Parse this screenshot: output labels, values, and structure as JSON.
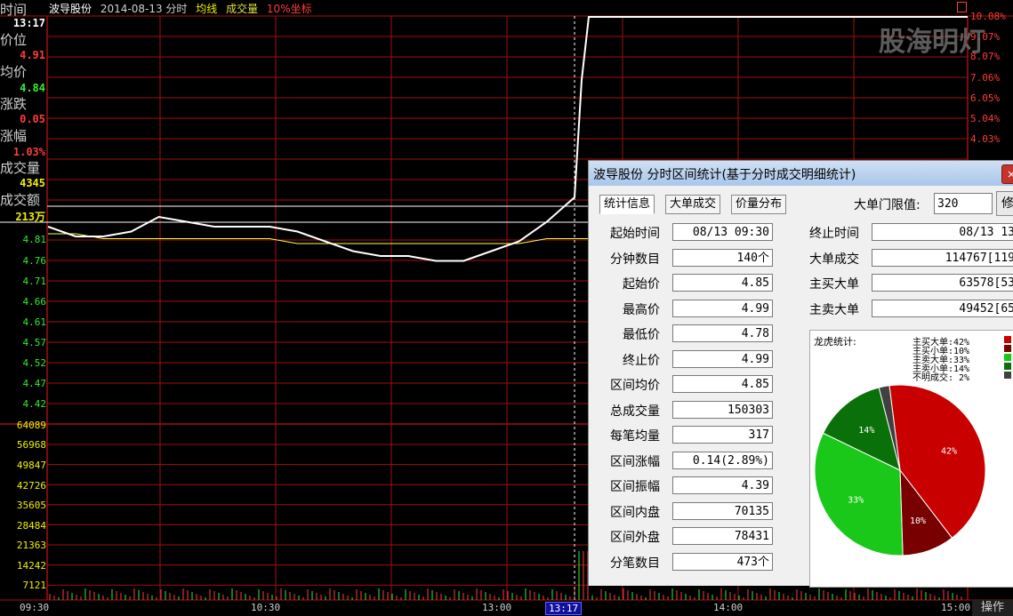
{
  "header": {
    "stock_name": "波导股份",
    "date_mode": "2014-08-13 分时",
    "avg_line": "均线",
    "volume": "成交量",
    "coord": "10%坐标",
    "corner_icon": "window-icon"
  },
  "watermark": "股海明灯",
  "info": {
    "time_label": "时间",
    "time_value": "13:17",
    "price_label": "价位",
    "price_value": "4.91",
    "avg_label": "均价",
    "avg_value": "4.84",
    "change_label": "涨跌",
    "change_value": "0.05",
    "pct_label": "涨幅",
    "pct_value": "1.03%",
    "vol_label": "成交量",
    "vol_value": "4345",
    "amt_label": "成交额",
    "amt_value": "213万"
  },
  "price_ticks": [
    "4.81",
    "4.76",
    "4.71",
    "4.66",
    "4.61",
    "4.57",
    "4.52",
    "4.47",
    "4.42"
  ],
  "volume_ticks": [
    "64089",
    "56968",
    "49847",
    "42726",
    "35605",
    "28484",
    "21363",
    "14242",
    "7121"
  ],
  "pct_ticks": [
    "10.08%",
    "9.07%",
    "8.07%",
    "7.06%",
    "6.05%",
    "5.04%",
    "4.03%"
  ],
  "time_ticks": [
    "09:30",
    "10:30",
    "13:00",
    "13:17",
    "14:00",
    "15:00"
  ],
  "operate_label": "操作",
  "colors": {
    "up": "#ff3c3c",
    "down": "#2ef02e",
    "price_line": "#ffffff",
    "avg_line": "#ffff50",
    "grid": "#a01010"
  },
  "price_series": {
    "avg_values": [
      4.85,
      4.85,
      4.84,
      4.84,
      4.84,
      4.84,
      4.84,
      4.84,
      4.84,
      4.83,
      4.83,
      4.83,
      4.83,
      4.83,
      4.83,
      4.83,
      4.83,
      4.83,
      4.84,
      4.84,
      4.84,
      4.84,
      4.86,
      4.88,
      4.91,
      4.93,
      4.94,
      4.94,
      4.95,
      4.95
    ],
    "price_values": [
      4.85,
      4.83,
      4.83,
      4.84,
      4.87,
      4.86,
      4.85,
      4.85,
      4.85,
      4.84,
      4.82,
      4.8,
      4.79,
      4.79,
      4.78,
      4.78,
      4.8,
      4.82,
      4.86,
      4.91,
      5.15,
      5.35,
      5.37,
      5.37,
      5.37,
      5.37,
      5.37,
      5.37,
      5.37,
      5.37
    ]
  },
  "dialog": {
    "title": "波导股份 分时区间统计(基于分时成交明细统计)",
    "close": "×",
    "tabs": [
      "统计信息",
      "大单成交",
      "价量分布"
    ],
    "threshold_label": "大单门限值:",
    "threshold_value": "320",
    "modify_button": "修",
    "fields": [
      {
        "label": "起始时间",
        "value": "08/13 09:30"
      },
      {
        "label": "分钟数目",
        "value": "140个"
      },
      {
        "label": "起始价",
        "value": "4.85"
      },
      {
        "label": "最高价",
        "value": "4.99"
      },
      {
        "label": "最低价",
        "value": "4.78"
      },
      {
        "label": "终止价",
        "value": "4.99"
      },
      {
        "label": "区间均价",
        "value": "4.85"
      },
      {
        "label": "总成交量",
        "value": "150303"
      },
      {
        "label": "每笔均量",
        "value": "317"
      },
      {
        "label": "区间涨幅",
        "value": "0.14(2.89%)"
      },
      {
        "label": "区间振幅",
        "value": "4.39"
      },
      {
        "label": "区间内盘",
        "value": "70135"
      },
      {
        "label": "区间外盘",
        "value": "78431"
      },
      {
        "label": "分笔数目",
        "value": "473个"
      }
    ],
    "right_fields": [
      {
        "label": "终止时间",
        "value": "08/13 13"
      },
      {
        "label": "大单成交",
        "value": "114767[119"
      },
      {
        "label": "主买大单",
        "value": "63578[53"
      },
      {
        "label": "主卖大单",
        "value": "49452[65"
      }
    ],
    "longhu_label": "龙虎统计:",
    "legend": [
      {
        "name": "主买大单",
        "pct": "42%",
        "color": "#c80000"
      },
      {
        "name": "主买小单",
        "pct": "10%",
        "color": "#780000"
      },
      {
        "name": "主卖大单",
        "pct": "33%",
        "color": "#19c819"
      },
      {
        "name": "主卖小单",
        "pct": "14%",
        "color": "#0a700a"
      },
      {
        "name": "不明成交",
        "pct": "2%",
        "color": "#404040"
      }
    ]
  },
  "chart_data": {
    "type": "pie",
    "title": "龙虎统计:",
    "categories": [
      "主买大单",
      "主买小单",
      "主卖大单",
      "主卖小单",
      "不明成交"
    ],
    "values": [
      42,
      10,
      33,
      14,
      2
    ]
  }
}
